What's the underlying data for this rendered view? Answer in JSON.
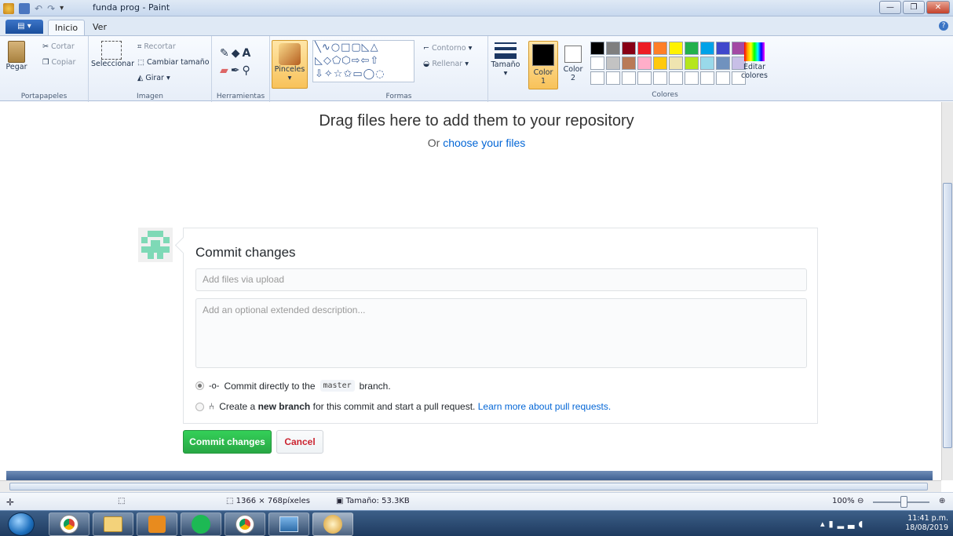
{
  "window": {
    "title": "funda prog - Paint"
  },
  "tabs": {
    "file": "▤ ▾",
    "inicio": "Inicio",
    "ver": "Ver"
  },
  "ribbon": {
    "portapapeles": {
      "paste": "Pegar",
      "cut": "Cortar",
      "copy": "Copiar",
      "label": "Portapapeles"
    },
    "imagen": {
      "select": "Seleccionar",
      "crop": "Recortar",
      "resize": "Cambiar tamaño",
      "rotate": "Girar",
      "label": "Imagen"
    },
    "herramientas": {
      "label": "Herramientas"
    },
    "pinceles": "Pinceles",
    "formas": {
      "outline": "Contorno",
      "fill": "Rellenar",
      "label": "Formas"
    },
    "tamano": "Tamaño",
    "color1": "Color 1",
    "color2": "Color 2",
    "colores_label": "Colores",
    "edit_colors": "Editar colores",
    "palette": [
      "#000000",
      "#7f7f7f",
      "#880015",
      "#ed1c24",
      "#ff7f27",
      "#fff200",
      "#22b14c",
      "#00a2e8",
      "#3f48cc",
      "#a349a4",
      "#ffffff",
      "#c3c3c3",
      "#b97a57",
      "#ffaec9",
      "#ffc90e",
      "#efe4b0",
      "#b5e61d",
      "#99d9ea",
      "#7092be",
      "#c8bfe7"
    ]
  },
  "page": {
    "drag_title": "Drag files here to add them to your repository",
    "drag_or": "Or",
    "drag_link": "choose your files",
    "commit_title": "Commit changes",
    "summary_placeholder": "Add files via upload",
    "desc_placeholder": "Add an optional extended description...",
    "opt1_pre": "Commit directly to the",
    "opt1_branch": "master",
    "opt1_post": "branch.",
    "opt2_pre": "Create a",
    "opt2_bold": "new branch",
    "opt2_mid": "for this commit and start a pull request.",
    "opt2_link": "Learn more about pull requests.",
    "commit_button": "Commit changes",
    "cancel_button": "Cancel"
  },
  "status": {
    "dimensions": "1366 × 768píxeles",
    "size": "Tamaño: 53.3KB",
    "zoom": "100%"
  },
  "clock": {
    "time": "11:41 p.m.",
    "date": "18/08/2019"
  }
}
